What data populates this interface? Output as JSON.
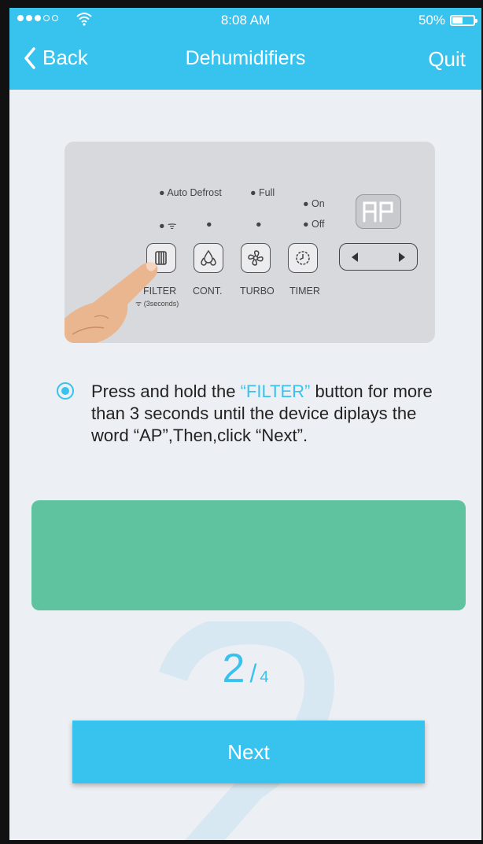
{
  "status_bar": {
    "time": "8:08 AM",
    "battery_percent": "50%",
    "battery_level": 0.5,
    "signal_bars_filled": 3,
    "signal_bars_total": 5
  },
  "nav": {
    "back_label": "Back",
    "title": "Dehumidifiers",
    "quit_label": "Quit"
  },
  "panel": {
    "auto_defrost": "Auto Defrost",
    "full": "Full",
    "on": "On",
    "off": "Off",
    "display_text": "AP",
    "buttons": [
      {
        "label": "FILTER",
        "icon": "filter-icon"
      },
      {
        "label": "CONT.",
        "icon": "drops-icon"
      },
      {
        "label": "TURBO",
        "icon": "fan-icon"
      },
      {
        "label": "TIMER",
        "icon": "clock-icon"
      }
    ],
    "filter_hint": "(3seconds)"
  },
  "instruction": {
    "part1": "Press and hold the ",
    "highlight": "“FILTER”",
    "part2": " button for more than 3 seconds until the device diplays the word “AP”,Then,click “Next”."
  },
  "step": {
    "current": "2",
    "separator": "/",
    "total": "4"
  },
  "next_label": "Next",
  "colors": {
    "accent": "#38c2ee",
    "green_panel": "#5ec39e",
    "background": "#eceff3"
  }
}
